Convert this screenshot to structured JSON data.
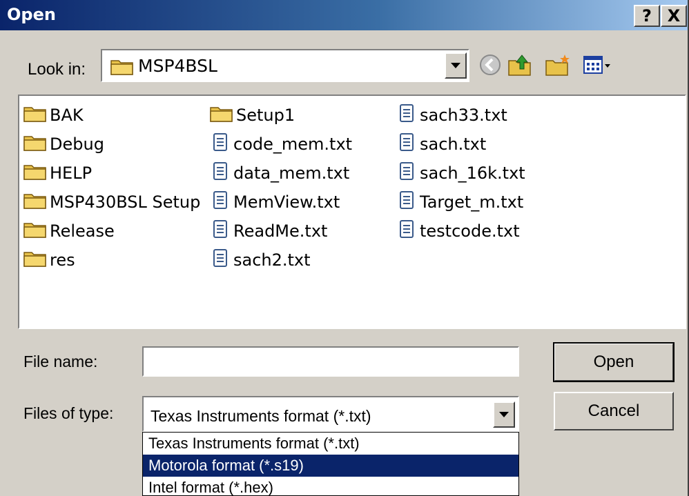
{
  "title": "Open",
  "caption_buttons": {
    "help": "?",
    "close": "X"
  },
  "look_in": {
    "label": "Look in:",
    "value": "MSP4BSL"
  },
  "toolbar": [
    "back-icon",
    "up-folder-icon",
    "new-folder-icon",
    "view-menu-icon"
  ],
  "files": [
    {
      "name": "BAK",
      "type": "folder"
    },
    {
      "name": "Debug",
      "type": "folder"
    },
    {
      "name": "HELP",
      "type": "folder"
    },
    {
      "name": "MSP430BSL Setup",
      "type": "folder"
    },
    {
      "name": "Release",
      "type": "folder"
    },
    {
      "name": "res",
      "type": "folder"
    },
    {
      "name": "Setup1",
      "type": "folder"
    },
    {
      "name": "code_mem.txt",
      "type": "text"
    },
    {
      "name": "data_mem.txt",
      "type": "text"
    },
    {
      "name": "MemView.txt",
      "type": "text"
    },
    {
      "name": "ReadMe.txt",
      "type": "text"
    },
    {
      "name": "sach2.txt",
      "type": "text"
    },
    {
      "name": "sach33.txt",
      "type": "text"
    },
    {
      "name": "sach.txt",
      "type": "text"
    },
    {
      "name": "sach_16k.txt",
      "type": "text"
    },
    {
      "name": "Target_m.txt",
      "type": "text"
    },
    {
      "name": "testcode.txt",
      "type": "text"
    }
  ],
  "file_name": {
    "label": "File name:",
    "value": ""
  },
  "file_type": {
    "label": "Files of type:",
    "value": "Texas Instruments format (*.txt)",
    "options": [
      "Texas Instruments format (*.txt)",
      "Motorola format  (*.s19)",
      "Intel format     (*.hex)"
    ],
    "selected_index": 1
  },
  "buttons": {
    "open": "Open",
    "cancel": "Cancel"
  },
  "colors": {
    "title_start": "#0a246a",
    "title_end": "#a6caf0",
    "face": "#d4d0c8",
    "selection": "#0a246a"
  }
}
